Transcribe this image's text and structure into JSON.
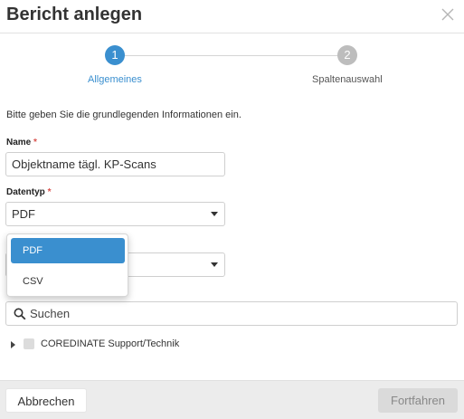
{
  "dialog": {
    "title": "Bericht anlegen",
    "close_icon": "close-icon"
  },
  "stepper": {
    "steps": [
      {
        "number": "1",
        "label": "Allgemeines",
        "active": true
      },
      {
        "number": "2",
        "label": "Spaltenauswahl",
        "active": false
      }
    ]
  },
  "intro": "Bitte geben Sie die grundlegenden Informationen ein.",
  "form": {
    "name_label": "Name",
    "name_required": "*",
    "name_value": "Objektname tägl. KP-Scans",
    "type_label": "Datentyp",
    "type_required": "*",
    "type_value": "PDF",
    "type_options": [
      "PDF",
      "CSV"
    ],
    "second_value": ""
  },
  "search": {
    "placeholder": "Suchen",
    "icon": "search-icon"
  },
  "tree": {
    "items": [
      {
        "label": "COREDINATE Support/Technik",
        "checked": false
      }
    ]
  },
  "footer": {
    "cancel_label": "Abbrechen",
    "next_label": "Fortfahren"
  },
  "colors": {
    "accent": "#3a8fcf",
    "required": "#d9534f",
    "inactive_step": "#bdbdbd"
  }
}
